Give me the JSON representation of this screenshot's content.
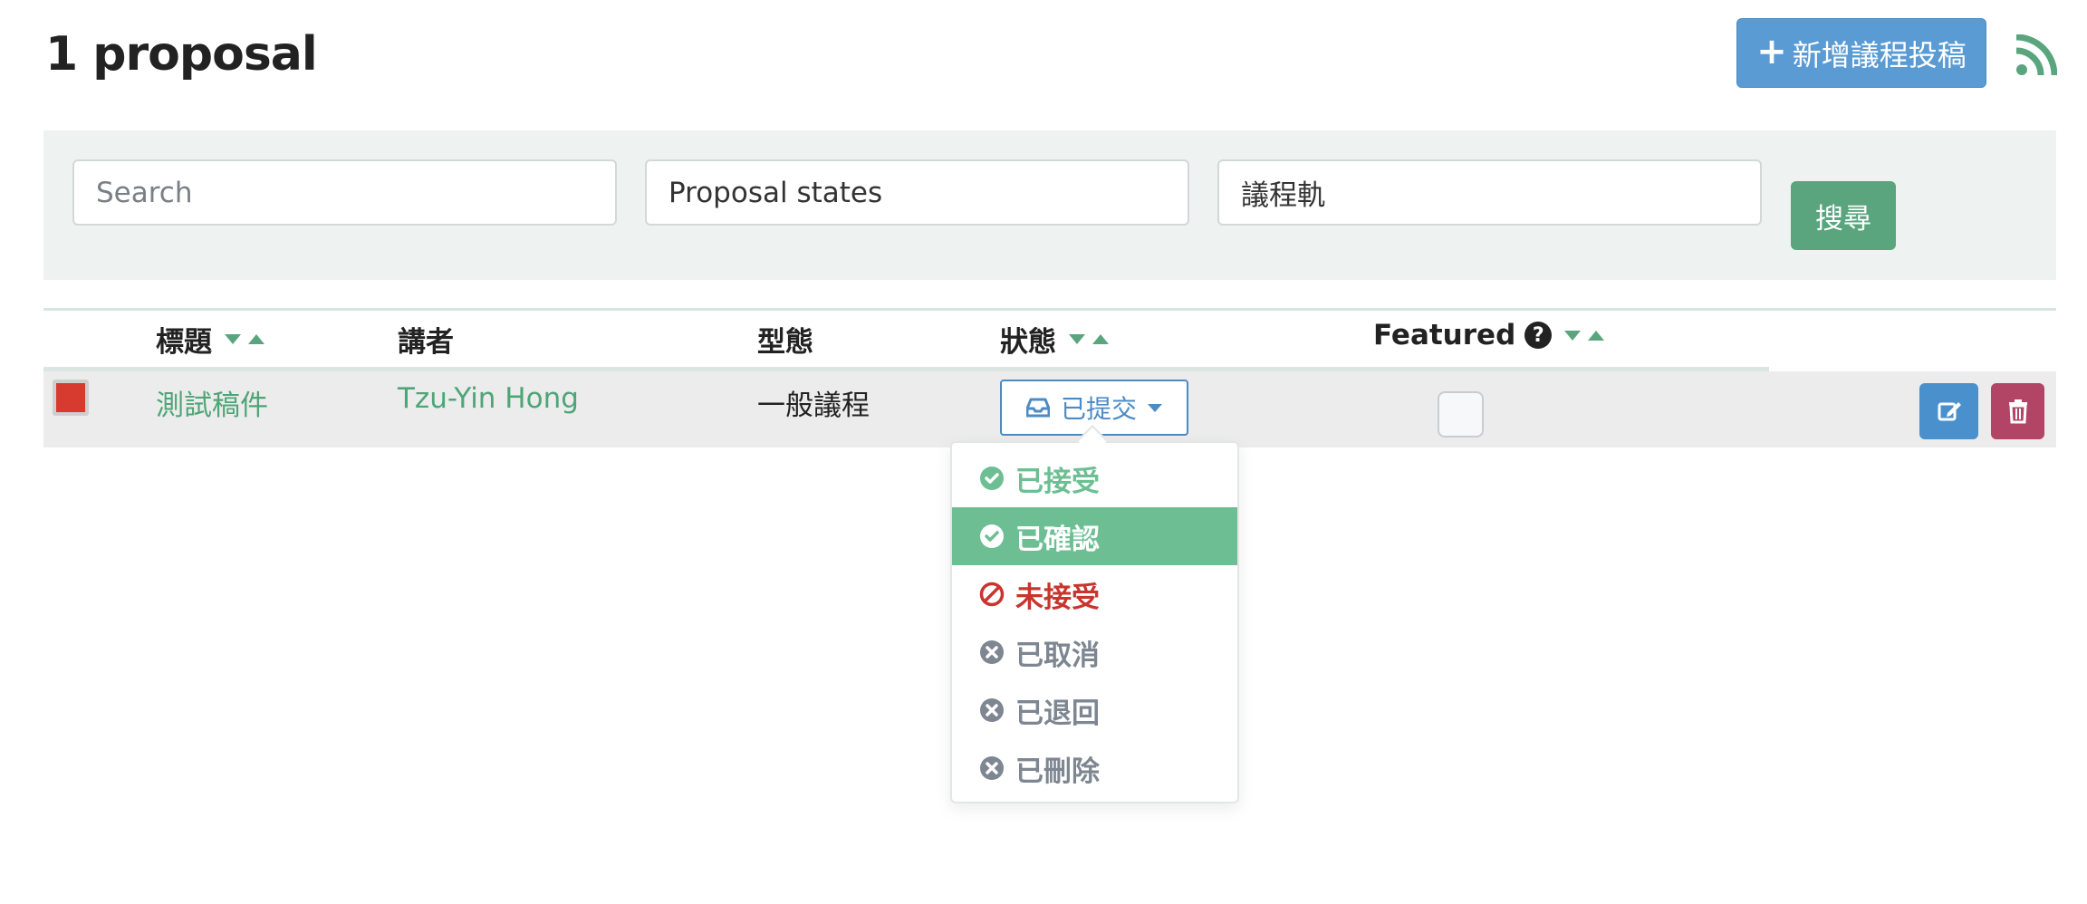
{
  "header": {
    "title": "1 proposal",
    "new_button_label": "新增議程投稿",
    "rss_icon": "rss-icon"
  },
  "filters": {
    "search_placeholder": "Search",
    "proposal_states": "Proposal states",
    "track": "議程軌",
    "search_button": "搜尋"
  },
  "table": {
    "headers": {
      "title": "標題",
      "speaker": "講者",
      "type": "型態",
      "status": "狀態",
      "featured": "Featured"
    },
    "rows": [
      {
        "color": "#d73a2f",
        "title": "測試稿件",
        "speaker": "Tzu-Yin Hong",
        "type": "一般議程",
        "status": "已提交",
        "featured": false
      }
    ]
  },
  "status_dropdown": {
    "options": [
      {
        "label": "已接受",
        "icon": "check-circle-icon",
        "color": "#6dbf93",
        "active": false
      },
      {
        "label": "已確認",
        "icon": "check-circle-icon",
        "color": "#ffffff",
        "active": true
      },
      {
        "label": "未接受",
        "icon": "ban-icon",
        "color": "#c8352f",
        "active": false
      },
      {
        "label": "已取消",
        "icon": "x-circle-icon",
        "color": "#7d8691",
        "active": false
      },
      {
        "label": "已退回",
        "icon": "x-circle-icon",
        "color": "#7d8691",
        "active": false
      },
      {
        "label": "已刪除",
        "icon": "x-circle-icon",
        "color": "#7d8691",
        "active": false
      }
    ]
  },
  "colors": {
    "accent_green": "#5aa57e",
    "primary_blue": "#5a9bd3",
    "danger": "#b24466"
  }
}
